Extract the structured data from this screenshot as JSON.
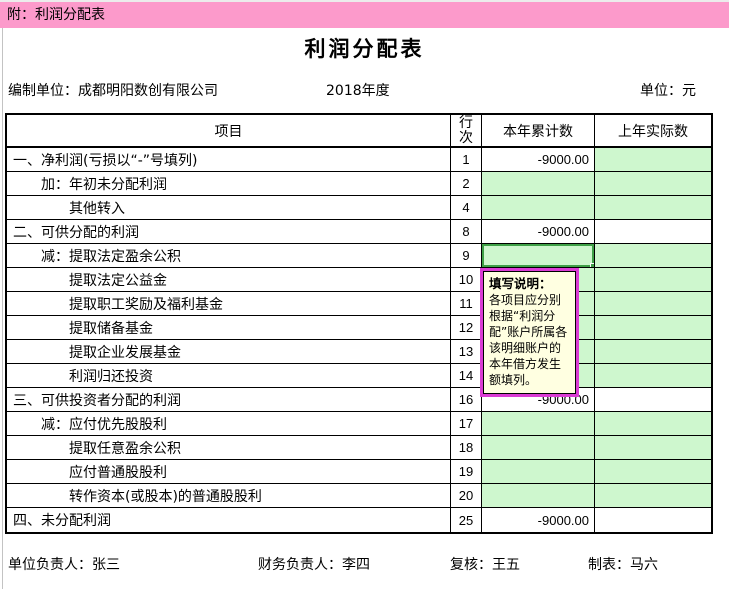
{
  "banner": {
    "label": "附：利润分配表"
  },
  "title": "利润分配表",
  "meta": {
    "prepared_by": "编制单位：成都明阳数创有限公司",
    "period": "2018年度",
    "unit": "单位：元"
  },
  "colors": {
    "banner_pink": "#FC9ACB",
    "input_cell_green": "#CEF7CE",
    "selection_green": "#3FA047",
    "comment_border_magenta": "#DA3BD4",
    "comment_background": "#FFFFE1"
  },
  "table": {
    "headers": {
      "item": "项目",
      "line_no": "行次",
      "current_year": "本年累计数",
      "prior_year": "上年实际数"
    },
    "rows": [
      {
        "item": "一、净利润(亏损以“-”号填列)",
        "indent": 0,
        "line_no": "1",
        "current": "-9000.00",
        "prior": "",
        "current_input": false,
        "prior_input": true,
        "selected": false
      },
      {
        "item": "加：年初未分配利润",
        "indent": 1,
        "line_no": "2",
        "current": "",
        "prior": "",
        "current_input": true,
        "prior_input": true,
        "selected": false
      },
      {
        "item": "其他转入",
        "indent": 2,
        "line_no": "4",
        "current": "",
        "prior": "",
        "current_input": true,
        "prior_input": true,
        "selected": false
      },
      {
        "item": "二、可供分配的利润",
        "indent": 0,
        "line_no": "8",
        "current": "-9000.00",
        "prior": "",
        "current_input": false,
        "prior_input": false,
        "selected": false
      },
      {
        "item": "减：提取法定盈余公积",
        "indent": 1,
        "line_no": "9",
        "current": "",
        "prior": "",
        "current_input": true,
        "prior_input": true,
        "selected": true
      },
      {
        "item": "提取法定公益金",
        "indent": 2,
        "line_no": "10",
        "current": "",
        "prior": "",
        "current_input": true,
        "prior_input": true,
        "selected": false
      },
      {
        "item": "提取职工奖励及福利基金",
        "indent": 2,
        "line_no": "11",
        "current": "",
        "prior": "",
        "current_input": true,
        "prior_input": true,
        "selected": false
      },
      {
        "item": "提取储备基金",
        "indent": 2,
        "line_no": "12",
        "current": "",
        "prior": "",
        "current_input": true,
        "prior_input": true,
        "selected": false
      },
      {
        "item": "提取企业发展基金",
        "indent": 2,
        "line_no": "13",
        "current": "",
        "prior": "",
        "current_input": true,
        "prior_input": true,
        "selected": false
      },
      {
        "item": "利润归还投资",
        "indent": 2,
        "line_no": "14",
        "current": "",
        "prior": "",
        "current_input": true,
        "prior_input": true,
        "selected": false
      },
      {
        "item": "三、可供投资者分配的利润",
        "indent": 0,
        "line_no": "16",
        "current": "-9000.00",
        "prior": "",
        "current_input": false,
        "prior_input": false,
        "selected": false
      },
      {
        "item": "减：应付优先股股利",
        "indent": 1,
        "line_no": "17",
        "current": "",
        "prior": "",
        "current_input": true,
        "prior_input": true,
        "selected": false
      },
      {
        "item": "提取任意盈余公积",
        "indent": 2,
        "line_no": "18",
        "current": "",
        "prior": "",
        "current_input": true,
        "prior_input": true,
        "selected": false
      },
      {
        "item": "应付普通股股利",
        "indent": 2,
        "line_no": "19",
        "current": "",
        "prior": "",
        "current_input": true,
        "prior_input": true,
        "selected": false
      },
      {
        "item": "转作资本(或股本)的普通股股利",
        "indent": 2,
        "line_no": "20",
        "current": "",
        "prior": "",
        "current_input": true,
        "prior_input": true,
        "selected": false
      },
      {
        "item": "四、未分配利润",
        "indent": 0,
        "line_no": "25",
        "current": "-9000.00",
        "prior": "",
        "current_input": false,
        "prior_input": false,
        "selected": false
      }
    ]
  },
  "comment": {
    "title": "填写说明：",
    "body": "各项目应分别根据“利润分配”账户所属各该明细账户的本年借方发生额填列。"
  },
  "footer": {
    "unit_head": "单位负责人：张三",
    "finance_head": "财务负责人：李四",
    "reviewer": "复核：王五",
    "preparer": "制表：马六"
  }
}
